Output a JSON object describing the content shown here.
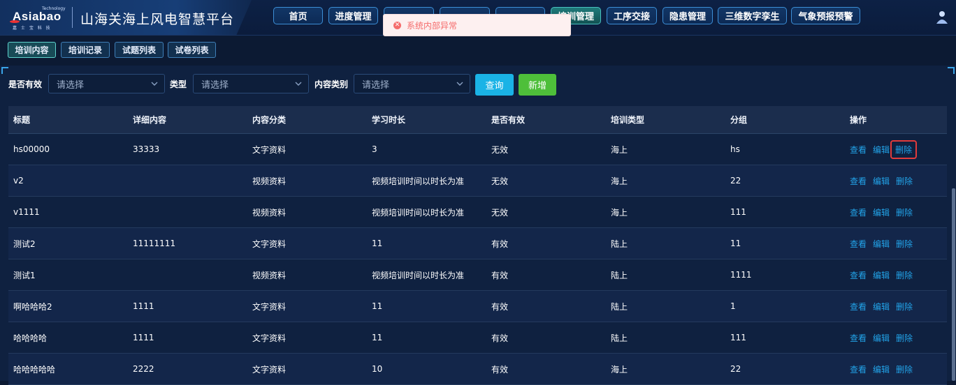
{
  "brand": {
    "logo_text": "Asiabao",
    "logo_tech": "Technology",
    "logo_sub": "嘉 士 宝 科 技",
    "title": "山海关海上风电智慧平台"
  },
  "nav": [
    {
      "label": "首页",
      "active": false
    },
    {
      "label": "进度管理",
      "active": false
    },
    {
      "label": "",
      "active": false
    },
    {
      "label": "",
      "active": false
    },
    {
      "label": "",
      "active": false
    },
    {
      "label": "培训管理",
      "active": true
    },
    {
      "label": "工序交接",
      "active": false
    },
    {
      "label": "隐患管理",
      "active": false
    },
    {
      "label": "三维数字孪生",
      "active": false
    },
    {
      "label": "气象预报预警",
      "active": false
    }
  ],
  "toast": {
    "message": "系统内部异常",
    "icon": "error-circle-icon",
    "color": "#f56c6c"
  },
  "subtabs": [
    {
      "label": "培训内容",
      "active": true
    },
    {
      "label": "培训记录",
      "active": false
    },
    {
      "label": "试题列表",
      "active": false
    },
    {
      "label": "试卷列表",
      "active": false
    }
  ],
  "filters": {
    "valid_label": "是否有效",
    "type_label": "类型",
    "category_label": "内容类别",
    "placeholder": "请选择",
    "query_button": "查询",
    "add_button": "新增"
  },
  "table": {
    "columns": [
      "标题",
      "详细内容",
      "内容分类",
      "学习时长",
      "是否有效",
      "培训类型",
      "分组",
      "操作"
    ],
    "actions": {
      "view": "查看",
      "edit": "编辑",
      "delete": "删除"
    },
    "rows": [
      [
        "hs00000",
        "33333",
        "文字资料",
        "3",
        "无效",
        "海上",
        "hs"
      ],
      [
        "v2",
        "",
        "视频资料",
        "视频培训时间以时长为准",
        "无效",
        "海上",
        "22"
      ],
      [
        "v1111",
        "",
        "视频资料",
        "视频培训时间以时长为准",
        "无效",
        "海上",
        "111"
      ],
      [
        "测试2",
        "11111111",
        "文字资料",
        "11",
        "有效",
        "陆上",
        "11"
      ],
      [
        "测试1",
        "",
        "视频资料",
        "视频培训时间以时长为准",
        "有效",
        "陆上",
        "1111"
      ],
      [
        "啊哈哈哈2",
        "1111",
        "文字资料",
        "11",
        "有效",
        "陆上",
        "1"
      ],
      [
        "哈哈哈哈",
        "1111",
        "文字资料",
        "11",
        "有效",
        "陆上",
        "111"
      ],
      [
        "哈哈哈哈哈",
        "2222",
        "文字资料",
        "10",
        "有效",
        "海上",
        "22"
      ]
    ]
  },
  "colors": {
    "accent": "#1ab3e6",
    "add": "#4ebf3a",
    "link": "#22a3e8",
    "highlight": "#e23b3b"
  }
}
